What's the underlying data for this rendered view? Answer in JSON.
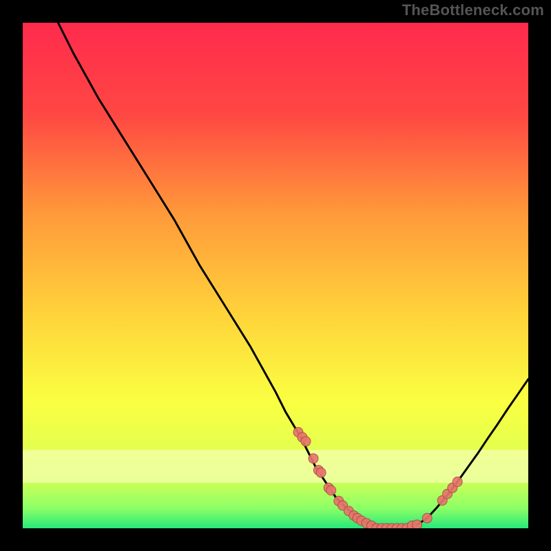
{
  "watermark": "TheBottleneck.com",
  "colors": {
    "background": "#000000",
    "gradient_top": "#ff2a4d",
    "gradient_mid_upper": "#ff6a3b",
    "gradient_mid": "#ffd43a",
    "gradient_mid_lower": "#f6ff3a",
    "gradient_lower": "#caff55",
    "gradient_bottom": "#27e87a",
    "curve": "#000000",
    "dot_fill": "#e7766b",
    "dot_stroke": "#a84a44",
    "band_pale": "#fdffd2"
  },
  "chart_data": {
    "type": "line",
    "title": "",
    "xlabel": "",
    "ylabel": "",
    "xlim": [
      0,
      100
    ],
    "ylim": [
      0,
      100
    ],
    "grid": false,
    "legend": false,
    "series": [
      {
        "name": "curve",
        "x": [
          7,
          10,
          15,
          20,
          25,
          30,
          35,
          40,
          45,
          50,
          52,
          55,
          58,
          60,
          62,
          64,
          66,
          68,
          70,
          72,
          74,
          76,
          78,
          80,
          82,
          84,
          86,
          88,
          90,
          92,
          94,
          96,
          98,
          100
        ],
        "y": [
          100,
          94,
          85,
          77,
          69,
          61,
          52,
          44,
          36,
          27,
          23,
          18,
          12,
          9,
          6,
          4,
          2.5,
          1.2,
          0.5,
          0,
          0,
          0,
          0.7,
          2,
          4.2,
          6.6,
          9.2,
          12,
          14.8,
          17.8,
          20.7,
          23.7,
          26.6,
          29.5
        ]
      }
    ],
    "scatter_points": {
      "name": "dots",
      "x": [
        54.5,
        55.3,
        56.0,
        57.5,
        58.5,
        59.0,
        60.5,
        61.0,
        62.5,
        63.3,
        64.5,
        65.5,
        66.2,
        67.0,
        68.0,
        69.0,
        70.0,
        71.0,
        72.0,
        73.0,
        74.0,
        75.0,
        76.0,
        77.0,
        78.0,
        80.0,
        83.0,
        84.0,
        85.0,
        86.0
      ],
      "y": [
        19.0,
        18.0,
        17.2,
        13.8,
        11.5,
        11.0,
        8.0,
        7.5,
        5.4,
        4.5,
        3.4,
        2.5,
        2.0,
        1.5,
        1.0,
        0.5,
        0,
        0,
        0,
        0,
        0,
        0,
        0,
        0.5,
        0.7,
        2.0,
        5.5,
        6.8,
        8.0,
        9.2
      ]
    }
  }
}
